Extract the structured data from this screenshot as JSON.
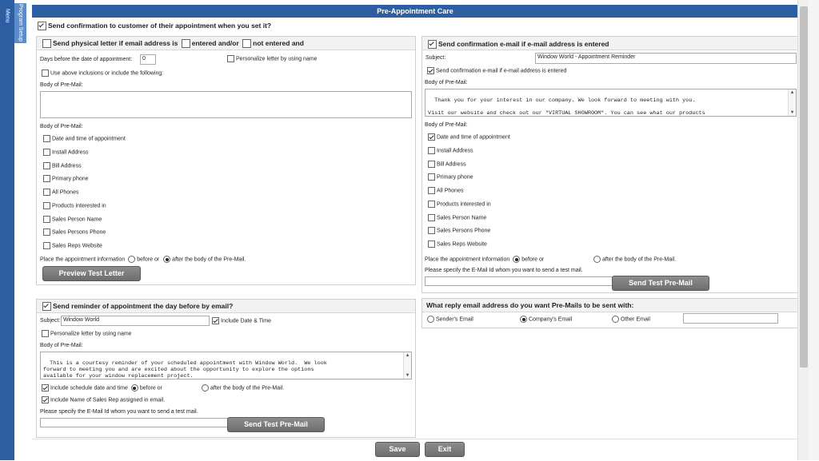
{
  "sidebar": {
    "menu_label": "Menu",
    "setup_label": "Program Setup"
  },
  "page_title": "Pre-Appointment Care",
  "master": {
    "label": "Send confirmation to customer of their appointment when you set it?",
    "checked": true
  },
  "letter": {
    "head_part1": "Send physical letter if email address is",
    "head_part2": "entered and/or",
    "head_part3": "not entered and",
    "days_label": "Days before the date of appointment:",
    "days_value": "0",
    "personalize_label": "Personalize letter by using name",
    "use_above_label": "Use above inclusions or include the following:",
    "body_label": "Body of Pre-Mail:",
    "body_value": "",
    "body_label2": "Body of Pre-Mail:",
    "items": [
      "Date and time of appointment",
      "Install Address",
      "Bill Address",
      "Primary phone",
      "All Phones",
      "Products interested in",
      "Sales Person Name",
      "Sales Persons Phone",
      "Sales Reps Website"
    ],
    "place_label": "Place the appointment information",
    "before_label": "before or",
    "after_label": "after the body of the Pre-Mail.",
    "preview_button": "Preview Test Letter"
  },
  "email_confirm": {
    "head": "Send confirmation e-mail if e-mail address is entered",
    "subject_label": "Subject:",
    "subject_value": "Window World - Appointment Reminder",
    "send_if_label": "Send confirmation e-mail if e-mail address is entered",
    "body_label": "Body of Pre-Mail:",
    "body_value": "Thank you for your interest in our company. We look forward to meeting with you.\n\nVisit our website and check out our \"VIRTUAL SHOWROOM\". You can see what our products\nwill look like in your home! You can also get other product details and technical information.",
    "body_label2": "Body of Pre-Mail:",
    "items": [
      "Date and time of appointment",
      "Install Address",
      "Bill Address",
      "Primary phone",
      "All Phones",
      "Products interested in",
      "Sales Person Name",
      "Sales Persons Phone",
      "Sales Reps Website"
    ],
    "place_label": "Place the appointment information",
    "before_label": "before or",
    "after_label": "after the body of the Pre-Mail.",
    "test_label": "Please specify the E-Mail Id whom you want to send a test mail.",
    "test_value": "",
    "test_button": "Send Test Pre-Mail"
  },
  "reminder": {
    "head": "Send reminder of appointment the day before by email?",
    "subject_label": "Subject:",
    "subject_value": "Window World",
    "include_date_label": "Include Date & Time",
    "personalize_label": "Personalize letter by using name",
    "body_label": "Body of Pre-Mail:",
    "body_value": "This is a courtesy reminder of your scheduled appointment with Window World.  We look\nforward to meeting you and are excited about the opportunity to explore the options\navailable for your window replacement project.",
    "include_schedule_label": "Include schedule date and time",
    "before_label": "before or",
    "after_label": "after the body of the Pre-Mail.",
    "include_rep_label": "Include Name of Sales Rep assigned in email.",
    "test_label": "Please specify the E-Mail Id whom you want to send a test mail.",
    "test_value": "",
    "test_button": "Send Test Pre-Mail"
  },
  "reply": {
    "head": "What reply email address do you want Pre-Mails to be sent with:",
    "senders_label": "Sender's Email",
    "company_label": "Company's Email",
    "other_label": "Other Email",
    "other_value": ""
  },
  "footer": {
    "save_button": "Save",
    "exit_button": "Exit"
  },
  "colors": {
    "accent": "#2d5ea1",
    "button": "#7a7a7a"
  }
}
